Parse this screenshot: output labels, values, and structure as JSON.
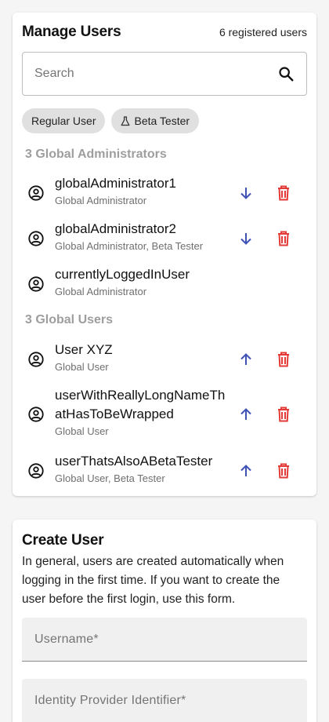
{
  "manage": {
    "title": "Manage Users",
    "count": "6 registered users",
    "search_placeholder": "Search",
    "filters": [
      {
        "label": "Regular User",
        "icon": ""
      },
      {
        "label": "Beta Tester",
        "icon": "flask-icon"
      }
    ],
    "groups": [
      {
        "heading": "3 Global Administrators"
      },
      {
        "heading": "3 Global Users"
      }
    ],
    "users": [
      {
        "name": "globalAdministrator1",
        "role": "Global Administrator",
        "action": "demote"
      },
      {
        "name": "globalAdministrator2",
        "role": "Global Administrator, Beta Tester",
        "action": "demote"
      },
      {
        "name": "currentlyLoggedInUser",
        "role": "Global Administrator",
        "action": ""
      },
      {
        "name": "User XYZ",
        "role": "Global User",
        "action": "promote"
      },
      {
        "name": "userWithReallyLongNameThatHasToBeWrapped",
        "role": "Global User",
        "action": "promote"
      },
      {
        "name": "userThatsAlsoABetaTester",
        "role": "Global User, Beta Tester",
        "action": "promote"
      }
    ]
  },
  "create": {
    "title": "Create User",
    "description": "In general, users are created automatically when logging in the first time. If you want to create the user before the first login, use this form.",
    "fields": [
      {
        "label": "Username*"
      },
      {
        "label": "Identity Provider Identifier*"
      }
    ]
  },
  "colors": {
    "accent": "#3f51b5",
    "danger": "#e53935",
    "muted": "#9e9e9e"
  }
}
